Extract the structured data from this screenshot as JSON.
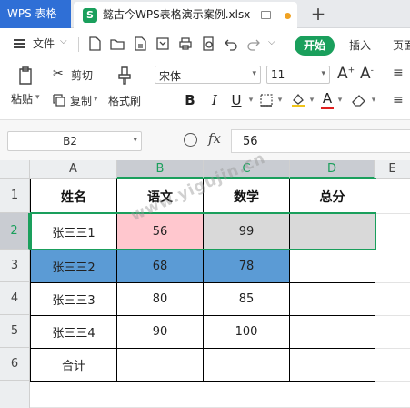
{
  "titlebar": {
    "app_tab": "WPS 表格",
    "doc_icon_letter": "S",
    "doc_name": "懿古今WPS表格演示案例.xlsx",
    "new_tab": "+"
  },
  "menubar": {
    "file": "文件",
    "start": "开始",
    "insert": "插入",
    "layout": "页面"
  },
  "ribbon": {
    "paste": "粘贴",
    "cut": "剪切",
    "copy": "复制",
    "format_painter": "格式刷",
    "font_name": "宋体",
    "font_size": "11",
    "bold": "B",
    "italic": "I",
    "underline": "U",
    "font_color_letter": "A",
    "grow_font": "A",
    "shrink_font": "A"
  },
  "formula_bar": {
    "cell_ref": "B2",
    "fx": "fx",
    "value": "56"
  },
  "sheet": {
    "columns": [
      "A",
      "B",
      "C",
      "D",
      "E"
    ],
    "rows": [
      "1",
      "2",
      "3",
      "4",
      "5",
      "6"
    ],
    "header": [
      "姓名",
      "语文",
      "数学",
      "总分"
    ],
    "data": [
      [
        "张三三1",
        "56",
        "99",
        ""
      ],
      [
        "张三三2",
        "68",
        "78",
        ""
      ],
      [
        "张三三3",
        "80",
        "85",
        ""
      ],
      [
        "张三三4",
        "90",
        "100",
        ""
      ],
      [
        "合计",
        "",
        "",
        ""
      ]
    ],
    "colors": {
      "b2_fill": "#ffc7ce",
      "c2_fill": "#d9d9d9",
      "d2_fill": "#d9d9d9",
      "row3_fill": "#5b9bd5",
      "selection": "#1a9f5c"
    }
  },
  "watermark": "www.yigujin.cn"
}
